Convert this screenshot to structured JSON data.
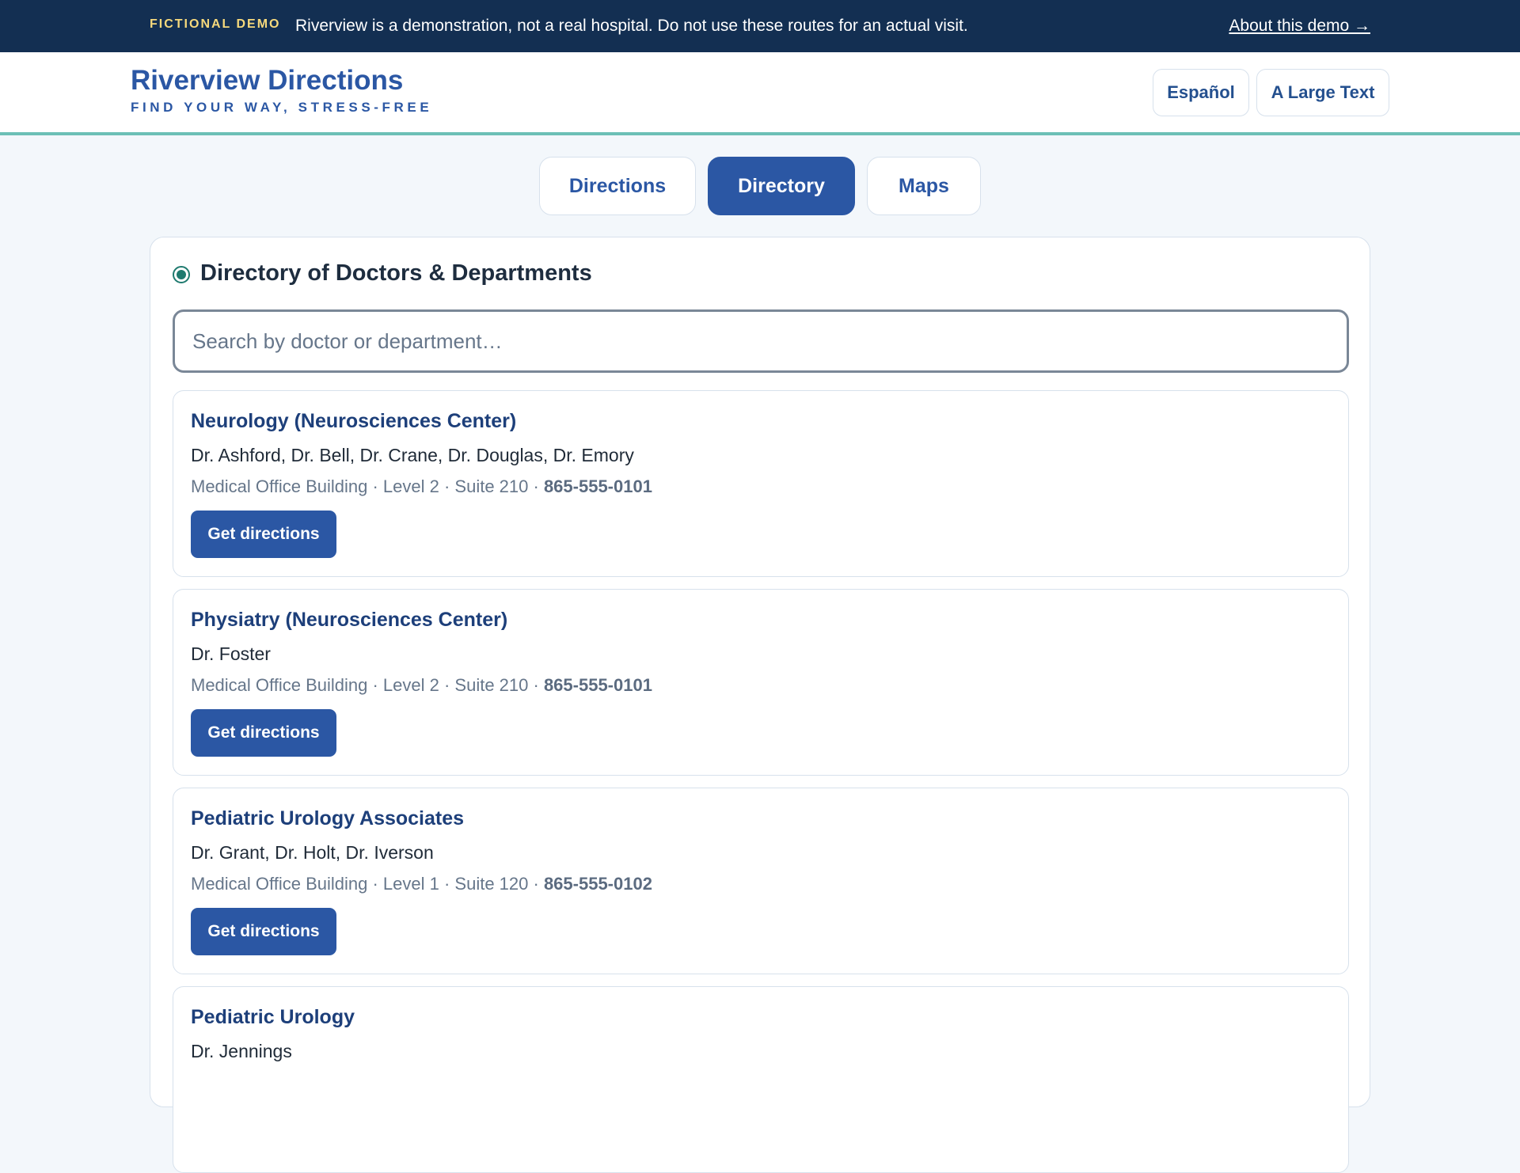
{
  "banner": {
    "tag": "FICTIONAL DEMO",
    "message": "Riverview is a demonstration, not a real hospital. Do not use these routes for an actual visit.",
    "about_link": "About this demo →"
  },
  "header": {
    "title": "Riverview Directions",
    "tagline": "FIND YOUR WAY, STRESS-FREE",
    "language_button": "Español",
    "large_text_button": "A Large Text"
  },
  "tabs": [
    {
      "label": "Directions",
      "active": false
    },
    {
      "label": "Directory",
      "active": true
    },
    {
      "label": "Maps",
      "active": false
    }
  ],
  "directory": {
    "heading": "Directory of Doctors & Departments",
    "search_placeholder": "Search by doctor or department…",
    "search_value": "",
    "entries": [
      {
        "department": "Neurology (Neurosciences Center)",
        "doctors": "Dr. Ashford, Dr. Bell, Dr. Crane, Dr. Douglas, Dr. Emory",
        "location": "Medical Office Building · Level 2 · Suite 210 · ",
        "phone": "865-555-0101",
        "button": "Get directions"
      },
      {
        "department": "Physiatry (Neurosciences Center)",
        "doctors": "Dr. Foster",
        "location": "Medical Office Building · Level 2 · Suite 210 · ",
        "phone": "865-555-0101",
        "button": "Get directions"
      },
      {
        "department": "Pediatric Urology Associates",
        "doctors": "Dr. Grant, Dr. Holt, Dr. Iverson",
        "location": "Medical Office Building · Level 1 · Suite 120 · ",
        "phone": "865-555-0102",
        "button": "Get directions"
      },
      {
        "department": "Pediatric Urology",
        "doctors": "Dr. Jennings"
      }
    ]
  },
  "colors": {
    "banner_bg": "#132f52",
    "banner_tag": "#f6d97c",
    "brand_blue": "#2b57a4",
    "header_rule": "#6bbfb6",
    "page_bg": "#f3f7fb",
    "heading_icon": "#1f7a6f"
  },
  "icons": {
    "heading": "radio-dot-icon"
  }
}
